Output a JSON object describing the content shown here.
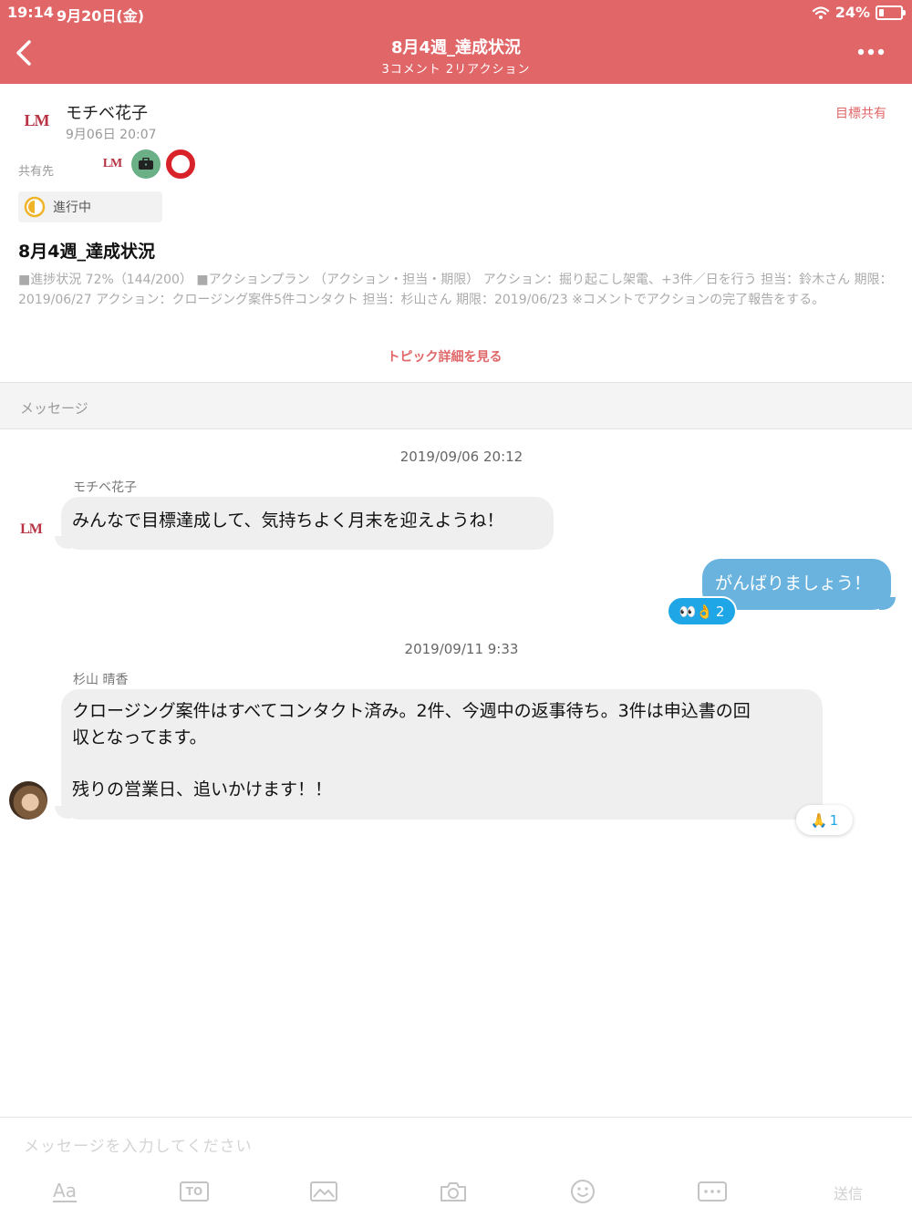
{
  "status_bar": {
    "time": "19:14",
    "date": "9月20日(金)",
    "battery": "24%"
  },
  "header": {
    "title": "8月4週_達成状況",
    "subtitle": "3コメント 2リアクション",
    "back_icon": "chevron-left-icon",
    "more_icon": "ellipsis-icon"
  },
  "topic": {
    "author_logo": "LM",
    "author_name": "モチベ花子",
    "author_date": "9月06日 20:07",
    "goal_share": "目標共有",
    "share_label": "共有先",
    "share_logo": "LM",
    "status": "進行中",
    "title": "8月4週_達成状況",
    "body": "■進捗状況 72%（144/200） ■アクションプラン （アクション・担当・期限） アクション：掘り起こし架電、+3件／日を行う 担当：鈴木さん 期限： 2019/06/27 アクション：クロージング案件5件コンタクト 担当：杉山さん 期限：2019/06/23 ※コメントでアクションの完了報告をする。",
    "detail_link": "トピック詳細を見る"
  },
  "section_label": "メッセージ",
  "messages": [
    {
      "timestamp": "2019/09/06 20:12",
      "sender": "モチベ花子",
      "avatar_logo": "LM",
      "text": "みんなで目標達成して、気持ちよく月末を迎えようね！"
    },
    {
      "text": "がんばりましょう！",
      "reaction": {
        "emoji": "👀👌",
        "count": "2"
      }
    },
    {
      "timestamp": "2019/09/11 9:33",
      "sender": "杉山 晴香",
      "line1": "クロージング案件はすべてコンタクト済み。2件、今週中の返事待ち。3件は申込書の回",
      "line2": "収となってます。",
      "line3": "残りの営業日、追いかけます！！",
      "reaction": {
        "emoji": "🙏",
        "count": "1"
      }
    }
  ],
  "input": {
    "placeholder": "メッセージを入力してください",
    "text_format_label": "Aa",
    "to_label": "TO",
    "send_label": "送信"
  },
  "colors": {
    "brand": "#e06668",
    "sent_bubble": "#6ab3df",
    "reaction_blue": "#1fa6e6"
  }
}
